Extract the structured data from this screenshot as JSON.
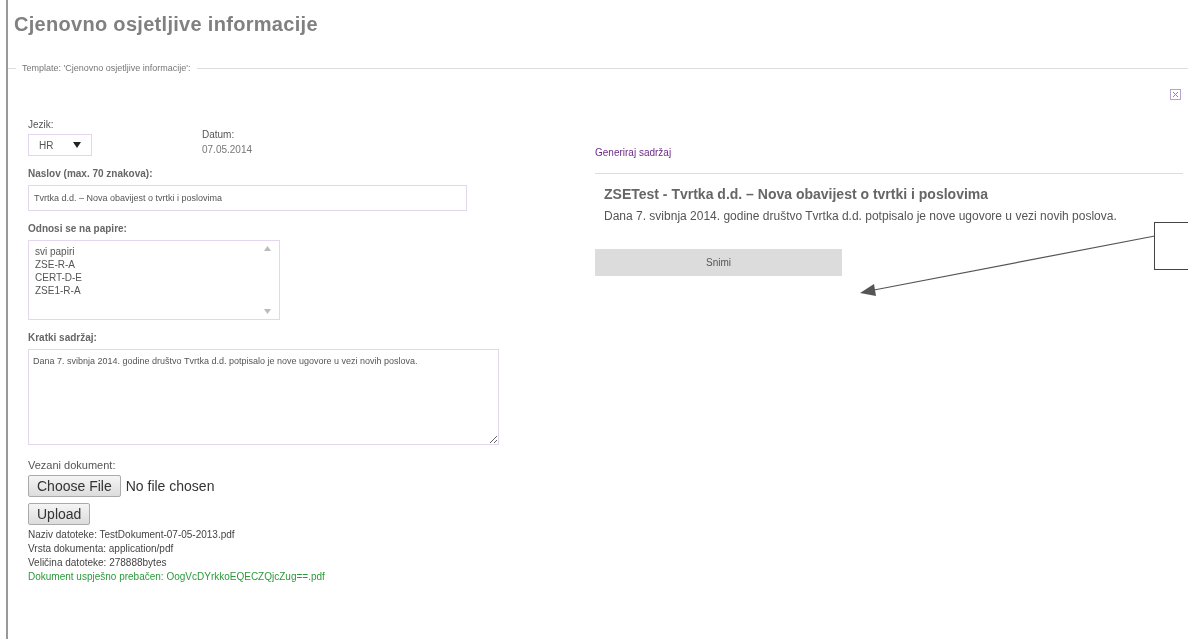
{
  "page_title": "Cjenovno osjetljive informacije",
  "template_legend": "Template: 'Cjenovno osjetljive informacije':",
  "language": {
    "label": "Jezik:",
    "value": "HR"
  },
  "date": {
    "label": "Datum:",
    "value": "07.05.2014"
  },
  "title_field": {
    "label": "Naslov (max. 70 znakova):",
    "value": "Tvrtka d.d. – Nova obavijest o tvrtki i poslovima"
  },
  "papers": {
    "label": "Odnosi se na papire:",
    "items": [
      "svi papiri",
      "ZSE-R-A",
      "CERT-D-E",
      "ZSE1-R-A"
    ]
  },
  "summary": {
    "label": "Kratki sadržaj:",
    "value": "Dana 7. svibnja 2014. godine društvo Tvrtka d.d. potpisalo je nove ugovore u vezi novih poslova."
  },
  "document": {
    "label": "Vezani dokument:",
    "choose_button": "Choose File",
    "file_status": "No file chosen",
    "upload_button": "Upload",
    "info": [
      {
        "text": "Naziv datoteke: TestDokument-07-05-2013.pdf",
        "kind": "info"
      },
      {
        "text": "Vrsta dokumenta: application/pdf",
        "kind": "info"
      },
      {
        "text": "Veličina datoteke: 278888bytes",
        "kind": "info"
      },
      {
        "text": "Dokument uspješno prebačen: OogVcDYrkkoEQECZQjcZug==.pdf",
        "kind": "success"
      }
    ]
  },
  "preview": {
    "heading": "Generiraj sadržaj",
    "title": "ZSETest - Tvrtka d.d. – Nova obavijest o tvrtki i poslovima",
    "body": "Dana 7. svibnja 2014. godine društvo Tvrtka d.d. potpisalo je nove ugovore u vezi novih poslova.",
    "save_button": "Snimi"
  }
}
